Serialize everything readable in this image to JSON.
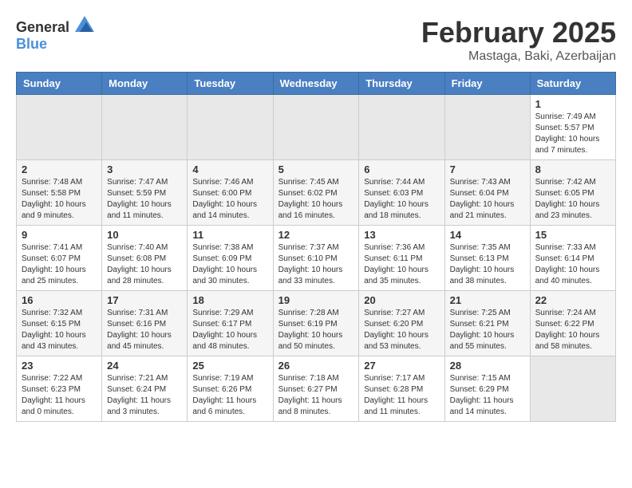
{
  "header": {
    "logo_general": "General",
    "logo_blue": "Blue",
    "month_title": "February 2025",
    "subtitle": "Mastaga, Baki, Azerbaijan"
  },
  "weekdays": [
    "Sunday",
    "Monday",
    "Tuesday",
    "Wednesday",
    "Thursday",
    "Friday",
    "Saturday"
  ],
  "weeks": [
    [
      {
        "day": "",
        "info": ""
      },
      {
        "day": "",
        "info": ""
      },
      {
        "day": "",
        "info": ""
      },
      {
        "day": "",
        "info": ""
      },
      {
        "day": "",
        "info": ""
      },
      {
        "day": "",
        "info": ""
      },
      {
        "day": "1",
        "info": "Sunrise: 7:49 AM\nSunset: 5:57 PM\nDaylight: 10 hours and 7 minutes."
      }
    ],
    [
      {
        "day": "2",
        "info": "Sunrise: 7:48 AM\nSunset: 5:58 PM\nDaylight: 10 hours and 9 minutes."
      },
      {
        "day": "3",
        "info": "Sunrise: 7:47 AM\nSunset: 5:59 PM\nDaylight: 10 hours and 11 minutes."
      },
      {
        "day": "4",
        "info": "Sunrise: 7:46 AM\nSunset: 6:00 PM\nDaylight: 10 hours and 14 minutes."
      },
      {
        "day": "5",
        "info": "Sunrise: 7:45 AM\nSunset: 6:02 PM\nDaylight: 10 hours and 16 minutes."
      },
      {
        "day": "6",
        "info": "Sunrise: 7:44 AM\nSunset: 6:03 PM\nDaylight: 10 hours and 18 minutes."
      },
      {
        "day": "7",
        "info": "Sunrise: 7:43 AM\nSunset: 6:04 PM\nDaylight: 10 hours and 21 minutes."
      },
      {
        "day": "8",
        "info": "Sunrise: 7:42 AM\nSunset: 6:05 PM\nDaylight: 10 hours and 23 minutes."
      }
    ],
    [
      {
        "day": "9",
        "info": "Sunrise: 7:41 AM\nSunset: 6:07 PM\nDaylight: 10 hours and 25 minutes."
      },
      {
        "day": "10",
        "info": "Sunrise: 7:40 AM\nSunset: 6:08 PM\nDaylight: 10 hours and 28 minutes."
      },
      {
        "day": "11",
        "info": "Sunrise: 7:38 AM\nSunset: 6:09 PM\nDaylight: 10 hours and 30 minutes."
      },
      {
        "day": "12",
        "info": "Sunrise: 7:37 AM\nSunset: 6:10 PM\nDaylight: 10 hours and 33 minutes."
      },
      {
        "day": "13",
        "info": "Sunrise: 7:36 AM\nSunset: 6:11 PM\nDaylight: 10 hours and 35 minutes."
      },
      {
        "day": "14",
        "info": "Sunrise: 7:35 AM\nSunset: 6:13 PM\nDaylight: 10 hours and 38 minutes."
      },
      {
        "day": "15",
        "info": "Sunrise: 7:33 AM\nSunset: 6:14 PM\nDaylight: 10 hours and 40 minutes."
      }
    ],
    [
      {
        "day": "16",
        "info": "Sunrise: 7:32 AM\nSunset: 6:15 PM\nDaylight: 10 hours and 43 minutes."
      },
      {
        "day": "17",
        "info": "Sunrise: 7:31 AM\nSunset: 6:16 PM\nDaylight: 10 hours and 45 minutes."
      },
      {
        "day": "18",
        "info": "Sunrise: 7:29 AM\nSunset: 6:17 PM\nDaylight: 10 hours and 48 minutes."
      },
      {
        "day": "19",
        "info": "Sunrise: 7:28 AM\nSunset: 6:19 PM\nDaylight: 10 hours and 50 minutes."
      },
      {
        "day": "20",
        "info": "Sunrise: 7:27 AM\nSunset: 6:20 PM\nDaylight: 10 hours and 53 minutes."
      },
      {
        "day": "21",
        "info": "Sunrise: 7:25 AM\nSunset: 6:21 PM\nDaylight: 10 hours and 55 minutes."
      },
      {
        "day": "22",
        "info": "Sunrise: 7:24 AM\nSunset: 6:22 PM\nDaylight: 10 hours and 58 minutes."
      }
    ],
    [
      {
        "day": "23",
        "info": "Sunrise: 7:22 AM\nSunset: 6:23 PM\nDaylight: 11 hours and 0 minutes."
      },
      {
        "day": "24",
        "info": "Sunrise: 7:21 AM\nSunset: 6:24 PM\nDaylight: 11 hours and 3 minutes."
      },
      {
        "day": "25",
        "info": "Sunrise: 7:19 AM\nSunset: 6:26 PM\nDaylight: 11 hours and 6 minutes."
      },
      {
        "day": "26",
        "info": "Sunrise: 7:18 AM\nSunset: 6:27 PM\nDaylight: 11 hours and 8 minutes."
      },
      {
        "day": "27",
        "info": "Sunrise: 7:17 AM\nSunset: 6:28 PM\nDaylight: 11 hours and 11 minutes."
      },
      {
        "day": "28",
        "info": "Sunrise: 7:15 AM\nSunset: 6:29 PM\nDaylight: 11 hours and 14 minutes."
      },
      {
        "day": "",
        "info": ""
      }
    ]
  ]
}
